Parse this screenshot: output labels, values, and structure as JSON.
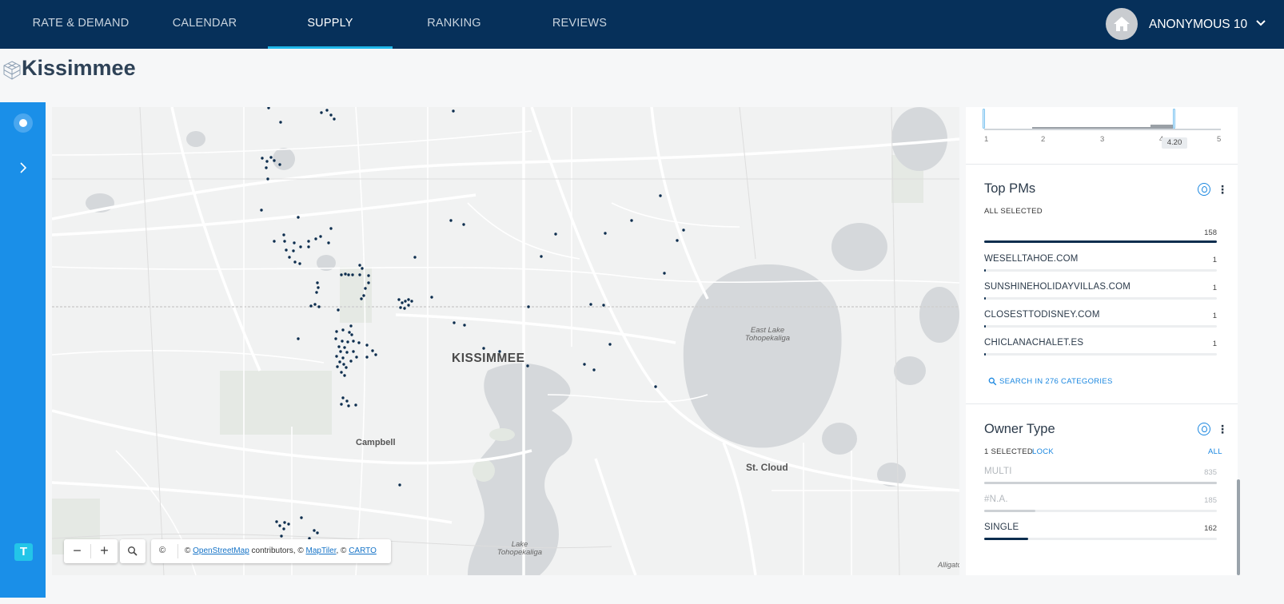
{
  "nav": {
    "tabs": [
      {
        "label": "RATE & DEMAND"
      },
      {
        "label": "CALENDAR"
      },
      {
        "label": "SUPPLY"
      },
      {
        "label": "RANKING"
      },
      {
        "label": "REVIEWS"
      }
    ],
    "active_tab": "SUPPLY",
    "user_name": "ANONYMOUS 10"
  },
  "page": {
    "title": "Kissimmee"
  },
  "map": {
    "labels": {
      "kissimmee": "KISSIMMEE",
      "campbell": "Campbell",
      "st_cloud": "St. Cloud",
      "east_lake": "East Lake\nTohopekaliga",
      "lake_toho": "Lake\nTohopekaliga",
      "alligator": "Alligato"
    },
    "controls": {
      "zoom_out": "−",
      "zoom_in": "+",
      "copyright": "©"
    },
    "attribution": {
      "prefix": "©",
      "osm": "OpenStreetMap",
      "mid1": "contributors, ©",
      "maptiler": "MapTiler",
      "mid2": ", ©",
      "carto": "CARTO"
    },
    "colors": {
      "marker": "#0c2d4e",
      "water": "#d5d8db",
      "roads": "#ffffff"
    }
  },
  "histogram": {
    "ticks": [
      "1",
      "2",
      "3",
      "4",
      "5"
    ],
    "selected_value": "4.20"
  },
  "top_pms": {
    "title": "Top PMs",
    "status": "ALL SELECTED",
    "total": 158,
    "rows": [
      {
        "label": "WESELLTAHOE.COM",
        "value": 1
      },
      {
        "label": "SUNSHINEHOLIDAYVILLAS.COM",
        "value": 1
      },
      {
        "label": "CLOSESTTODISNEY.COM",
        "value": 1
      },
      {
        "label": "CHICLANACHALET.ES",
        "value": 1
      }
    ],
    "search_label": "SEARCH IN 276 CATEGORIES"
  },
  "owner_type": {
    "title": "Owner Type",
    "status": "1 SELECTED",
    "lock_label": "LOCK",
    "all_label": "ALL",
    "rows": [
      {
        "label": "MULTI",
        "value": 835,
        "selected": false
      },
      {
        "label": "#N.A.",
        "value": 185,
        "selected": false
      },
      {
        "label": "SINGLE",
        "value": 162,
        "selected": true
      }
    ]
  },
  "rail": {
    "logo_letter": "T"
  }
}
